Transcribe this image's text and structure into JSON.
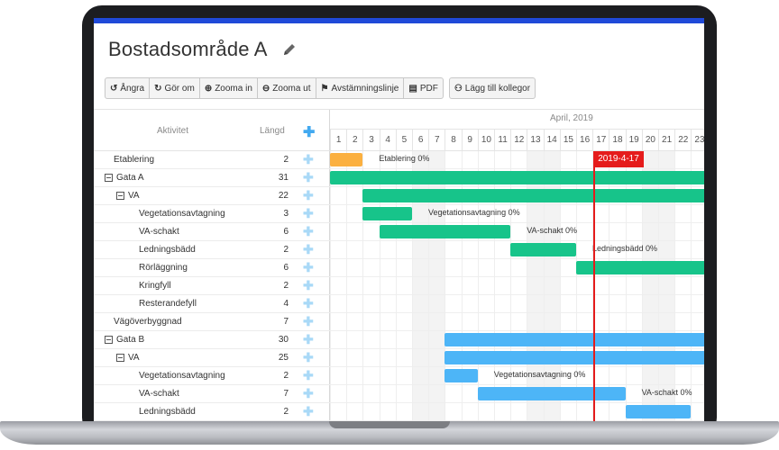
{
  "page": {
    "title": "Bostadsområde A"
  },
  "toolbar": {
    "buttons": [
      {
        "label": "Ångra",
        "icon": "undo-icon"
      },
      {
        "label": "Gör om",
        "icon": "redo-icon"
      },
      {
        "label": "Zooma in",
        "icon": "zoom-in-icon"
      },
      {
        "label": "Zooma ut",
        "icon": "zoom-out-icon"
      },
      {
        "label": "Avstämningslinje",
        "icon": "flag-icon"
      },
      {
        "label": "PDF",
        "icon": "file-icon"
      },
      {
        "label": "Lägg till kollegor",
        "icon": "add-user-icon"
      }
    ]
  },
  "grid": {
    "header": {
      "activity": "Aktivitet",
      "length": "Längd"
    },
    "rows": [
      {
        "name": "Etablering",
        "length": "2",
        "level": 0,
        "group": false
      },
      {
        "name": "Gata A",
        "length": "31",
        "level": 0,
        "group": true
      },
      {
        "name": "VA",
        "length": "22",
        "level": 1,
        "group": true
      },
      {
        "name": "Vegetationsavtagning",
        "length": "3",
        "level": 2,
        "group": false
      },
      {
        "name": "VA-schakt",
        "length": "6",
        "level": 2,
        "group": false
      },
      {
        "name": "Ledningsbädd",
        "length": "2",
        "level": 2,
        "group": false
      },
      {
        "name": "Rörläggning",
        "length": "6",
        "level": 2,
        "group": false
      },
      {
        "name": "Kringfyll",
        "length": "2",
        "level": 2,
        "group": false
      },
      {
        "name": "Resterandefyll",
        "length": "4",
        "level": 2,
        "group": false
      },
      {
        "name": "Vägöverbyggnad",
        "length": "7",
        "level": 0,
        "group": false
      },
      {
        "name": "Gata B",
        "length": "30",
        "level": 0,
        "group": true
      },
      {
        "name": "VA",
        "length": "25",
        "level": 1,
        "group": true
      },
      {
        "name": "Vegetationsavtagning",
        "length": "2",
        "level": 2,
        "group": false
      },
      {
        "name": "VA-schakt",
        "length": "7",
        "level": 2,
        "group": false
      },
      {
        "name": "Ledningsbädd",
        "length": "2",
        "level": 2,
        "group": false
      }
    ]
  },
  "timeline": {
    "month": "April, 2019",
    "days": [
      "1",
      "2",
      "3",
      "4",
      "5",
      "6",
      "7",
      "8",
      "9",
      "10",
      "11",
      "12",
      "13",
      "14",
      "15",
      "16",
      "17",
      "18",
      "19",
      "20",
      "21",
      "22",
      "23"
    ],
    "weekend_days": [
      6,
      7,
      13,
      14,
      20,
      21
    ],
    "today": {
      "label": "2019-4-17",
      "day": 17
    },
    "colors": {
      "orange": "#fbb040",
      "green": "#17c48a",
      "blue": "#4db5f7",
      "today": "#e51c1c"
    },
    "bars": [
      {
        "row": 0,
        "start": 1,
        "days": 2,
        "color": "orange",
        "label": "Etablering 0%"
      },
      {
        "row": 1,
        "start": 1,
        "days": 31,
        "color": "green",
        "label": ""
      },
      {
        "row": 2,
        "start": 3,
        "days": 22,
        "color": "green",
        "label": ""
      },
      {
        "row": 3,
        "start": 3,
        "days": 3,
        "color": "green",
        "label": "Vegetationsavtagning 0%"
      },
      {
        "row": 4,
        "start": 4,
        "days": 8,
        "color": "green",
        "label": "VA-schakt 0%"
      },
      {
        "row": 5,
        "start": 12,
        "days": 4,
        "color": "green",
        "label": "Ledningsbädd 0%"
      },
      {
        "row": 6,
        "start": 16,
        "days": 10,
        "color": "green",
        "label": ""
      },
      {
        "row": 10,
        "start": 8,
        "days": 30,
        "color": "blue",
        "label": ""
      },
      {
        "row": 11,
        "start": 8,
        "days": 25,
        "color": "blue",
        "label": ""
      },
      {
        "row": 12,
        "start": 8,
        "days": 2,
        "color": "blue",
        "label": "Vegetationsavtagning 0%"
      },
      {
        "row": 13,
        "start": 10,
        "days": 9,
        "color": "blue",
        "label": "VA-schakt 0%"
      },
      {
        "row": 14,
        "start": 19,
        "days": 4,
        "color": "blue",
        "label": ""
      }
    ]
  }
}
